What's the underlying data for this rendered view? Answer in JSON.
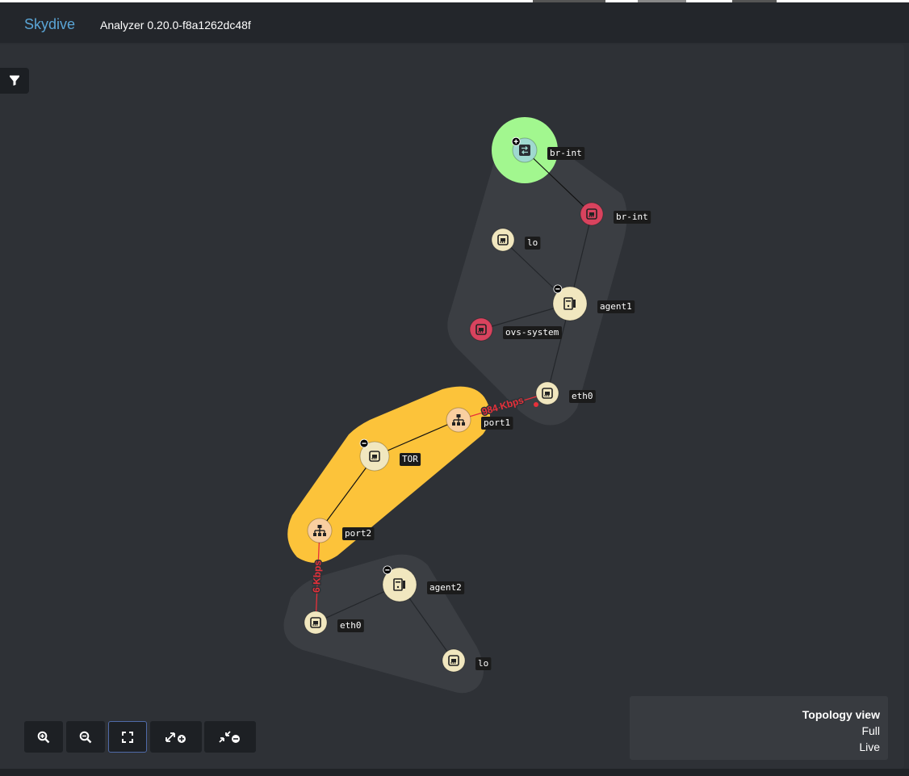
{
  "header": {
    "brand": "Skydive",
    "version": "Analyzer 0.20.0-f8a1262dc48f"
  },
  "topology": {
    "nodes": [
      {
        "id": "br-int-bridge",
        "label": "br-int",
        "icon": "bridge-icon",
        "fill": "#9fd9cf",
        "collapse": "+"
      },
      {
        "id": "br-int-iface",
        "label": "br-int",
        "icon": "interface-icon",
        "fill": "#d8435e"
      },
      {
        "id": "lo1",
        "label": "lo",
        "icon": "interface-icon",
        "fill": "#f1e7bf"
      },
      {
        "id": "agent1",
        "label": "agent1",
        "icon": "host-icon",
        "fill": "#f1e7bf",
        "collapse": "-"
      },
      {
        "id": "ovs-system",
        "label": "ovs-system",
        "icon": "interface-icon",
        "fill": "#d8435e"
      },
      {
        "id": "eth0a",
        "label": "eth0",
        "icon": "interface-icon",
        "fill": "#f1e7bf"
      },
      {
        "id": "port1",
        "label": "port1",
        "icon": "port-icon",
        "fill": "#f9cfa0"
      },
      {
        "id": "tor",
        "label": "TOR",
        "icon": "interface-icon",
        "fill": "#f1e7bf",
        "collapse": "-"
      },
      {
        "id": "port2",
        "label": "port2",
        "icon": "port-icon",
        "fill": "#f9cfa0"
      },
      {
        "id": "agent2",
        "label": "agent2",
        "icon": "host-icon",
        "fill": "#f1e7bf",
        "collapse": "-"
      },
      {
        "id": "eth0b",
        "label": "eth0",
        "icon": "interface-icon",
        "fill": "#f1e7bf"
      },
      {
        "id": "lo2",
        "label": "lo",
        "icon": "interface-icon",
        "fill": "#f1e7bf"
      }
    ],
    "links": [
      {
        "from": "br-int-bridge",
        "to": "br-int-iface"
      },
      {
        "from": "br-int-iface",
        "to": "agent1"
      },
      {
        "from": "lo1",
        "to": "agent1"
      },
      {
        "from": "ovs-system",
        "to": "agent1"
      },
      {
        "from": "agent1",
        "to": "eth0a"
      },
      {
        "from": "port1",
        "to": "tor"
      },
      {
        "from": "tor",
        "to": "port2"
      },
      {
        "from": "agent2",
        "to": "eth0b"
      },
      {
        "from": "agent2",
        "to": "lo2"
      }
    ],
    "traffic": [
      {
        "from": "eth0a",
        "to": "port1",
        "label": "984 Kbps"
      },
      {
        "from": "port2",
        "to": "eth0b",
        "label": "6 Kbps"
      }
    ],
    "groups": [
      {
        "name": "agent1-group",
        "color": "#3b3e43"
      },
      {
        "name": "tor-group",
        "color": "#fcc33a"
      },
      {
        "name": "agent2-group",
        "color": "#3b3e43"
      },
      {
        "name": "br-int-group",
        "color": "#a2f78f"
      }
    ]
  },
  "toolbar": {
    "zoom_in": "zoom-in",
    "zoom_out": "zoom-out",
    "fit": "fit",
    "expand": "expand-all",
    "collapse": "collapse-all"
  },
  "info": {
    "title": "Topology view",
    "mode": "Full",
    "state": "Live"
  },
  "colors": {
    "accent": "#5aa5d6",
    "traffic": "#e8303a",
    "background": "#2e3136"
  }
}
